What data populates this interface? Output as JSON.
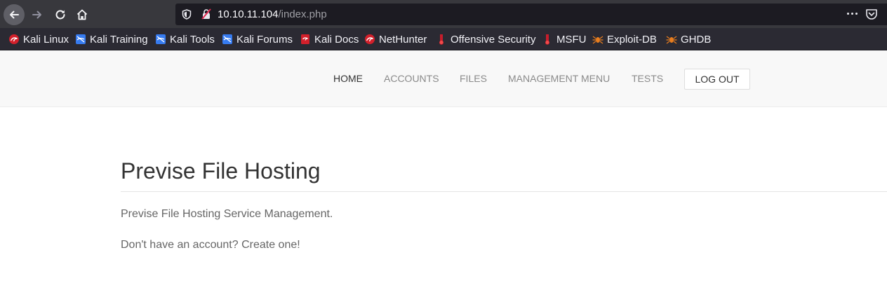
{
  "browser": {
    "url_host": "10.10.11.104",
    "url_path": "/index.php",
    "bookmarks": [
      {
        "label": "Kali Linux",
        "icon": "kali-dragon-icon"
      },
      {
        "label": "Kali Training",
        "icon": "kali-training-icon"
      },
      {
        "label": "Kali Tools",
        "icon": "kali-tools-icon"
      },
      {
        "label": "Kali Forums",
        "icon": "kali-forums-icon"
      },
      {
        "label": "Kali Docs",
        "icon": "kali-docs-icon"
      },
      {
        "label": "NetHunter",
        "icon": "nethunter-icon"
      },
      {
        "label": "Offensive Security",
        "icon": "offsec-icon"
      },
      {
        "label": "MSFU",
        "icon": "msfu-icon"
      },
      {
        "label": "Exploit-DB",
        "icon": "exploit-db-icon"
      },
      {
        "label": "GHDB",
        "icon": "ghdb-icon"
      }
    ]
  },
  "site": {
    "nav": {
      "home": "HOME",
      "accounts": "ACCOUNTS",
      "files": "FILES",
      "management": "MANAGEMENT MENU",
      "tests": "TESTS",
      "logout": "LOG OUT"
    },
    "title": "Previse File Hosting",
    "description": "Previse File Hosting Service Management.",
    "signup_prompt": "Don't have an account?",
    "signup_link": "Create one!"
  },
  "colors": {
    "toolbar": "#38383d",
    "urlbar": "#1c1b22",
    "bookmarks_bar": "#2b2a33",
    "nav_bg": "#f8f8f8",
    "kali_red": "#d3202b",
    "kali_blue": "#367bf0",
    "exploit_orange": "#e87d1e"
  }
}
